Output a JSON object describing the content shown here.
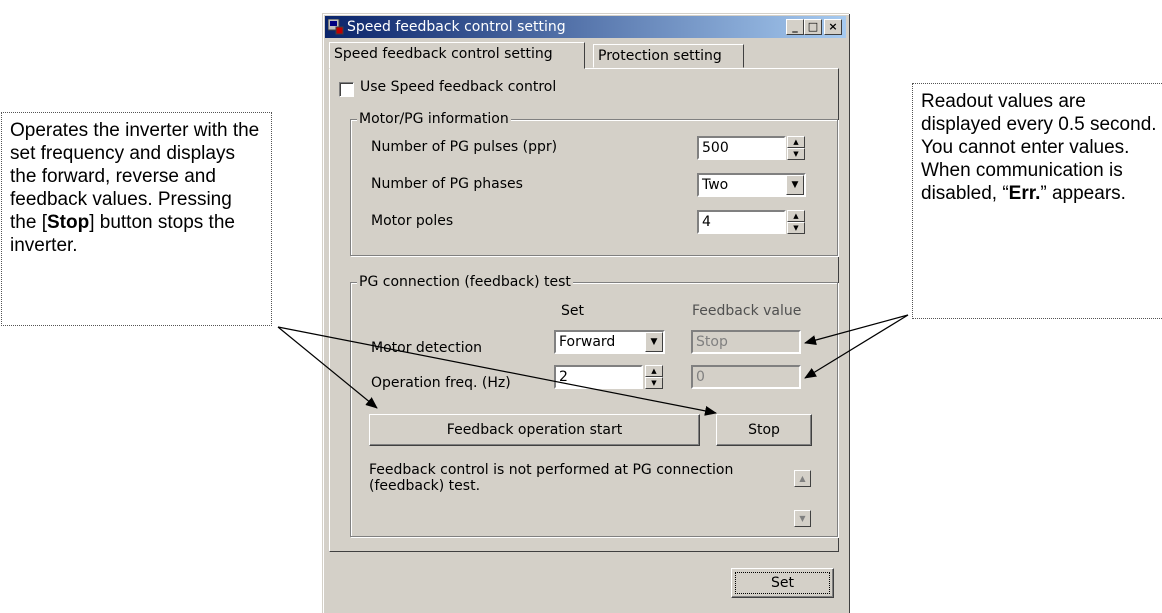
{
  "callouts": {
    "left": {
      "pre": "Operates the inverter with the set frequency and displays the forward, reverse and feedback values. Pressing the [",
      "bold": "Stop",
      "post": "] button stops the inverter."
    },
    "right": {
      "line1": "Readout values are displayed every 0.5 second. You cannot enter values.",
      "line2_pre": "When communication is disabled, “",
      "line2_bold": "Err.",
      "line2_post": "” appears."
    }
  },
  "window": {
    "title": "Speed feedback control setting",
    "minimize": "_",
    "maximize": "□",
    "close": "×"
  },
  "tabs": [
    {
      "label": "Speed feedback control setting",
      "active": true
    },
    {
      "label": "Protection setting",
      "active": false
    }
  ],
  "use_feedback": {
    "label": "Use Speed feedback control",
    "checked": false
  },
  "motor_pg": {
    "title": "Motor/PG information",
    "pg_pulses_label": "Number of PG pulses (ppr)",
    "pg_pulses_value": "500",
    "pg_phases_label": "Number of PG phases",
    "pg_phases_value": "Two",
    "poles_label": "Motor poles",
    "poles_value": "4"
  },
  "pg_test": {
    "title": "PG connection (feedback) test",
    "col_set": "Set",
    "col_feedback": "Feedback value",
    "motor_detection_label": "Motor detection",
    "motor_detection_set": "Forward",
    "motor_detection_feedback": "Stop",
    "op_freq_label": "Operation freq. (Hz)",
    "op_freq_set": "2",
    "op_freq_feedback": "0",
    "start_button": "Feedback operation start",
    "stop_button": "Stop",
    "note": "Feedback control is not performed at PG connection (feedback) test."
  },
  "set_button": "Set"
}
